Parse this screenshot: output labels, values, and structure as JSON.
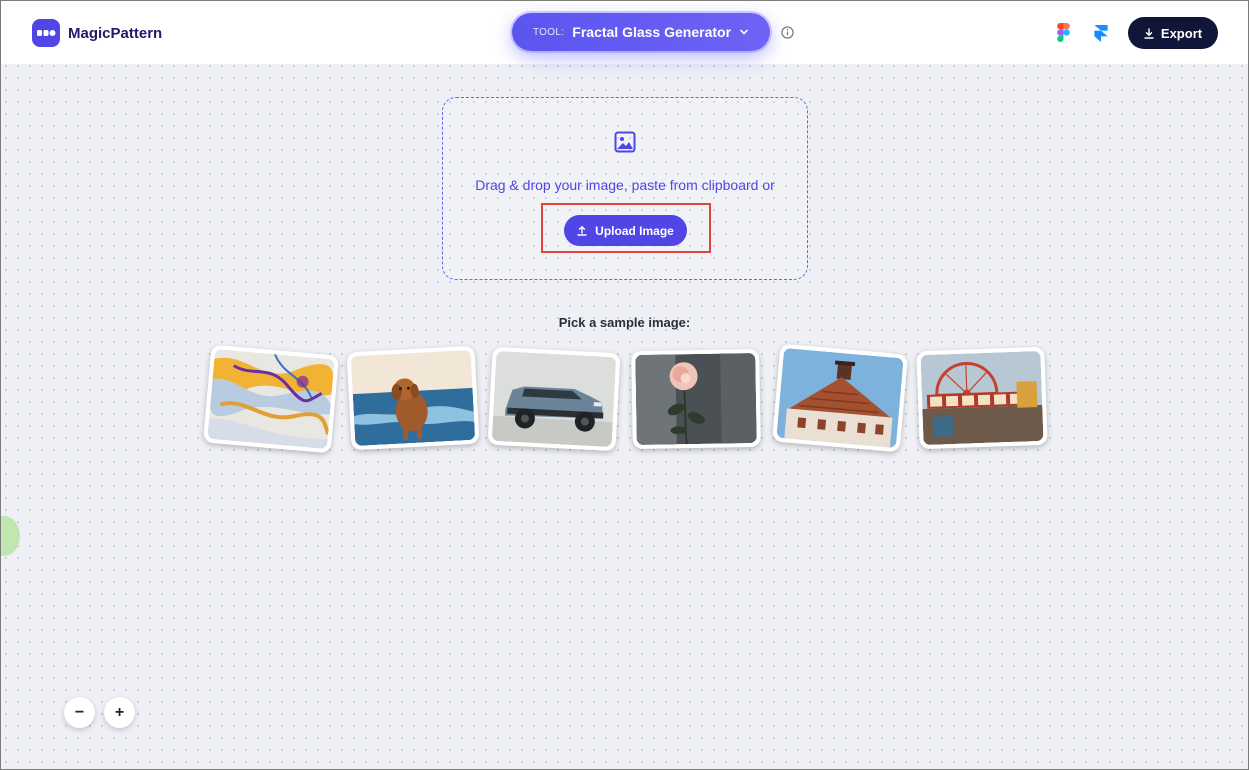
{
  "header": {
    "brand": "MagicPattern",
    "tool_prefix": "TOOL:",
    "tool_name": "Fractal Glass Generator",
    "export_label": "Export"
  },
  "upload": {
    "drop_text": "Drag & drop your image, paste from clipboard or",
    "button_label": "Upload Image"
  },
  "samples": {
    "title": "Pick a sample image:",
    "items": [
      "marbled-paint",
      "dog-beach",
      "blue-suv",
      "rose-flower",
      "roof-building",
      "ferris-wheel"
    ]
  },
  "zoom": {
    "minus": "−",
    "plus": "+"
  },
  "colors": {
    "accent": "#4f46e5",
    "export_bg": "#0f1638",
    "highlight": "#e3433c"
  }
}
